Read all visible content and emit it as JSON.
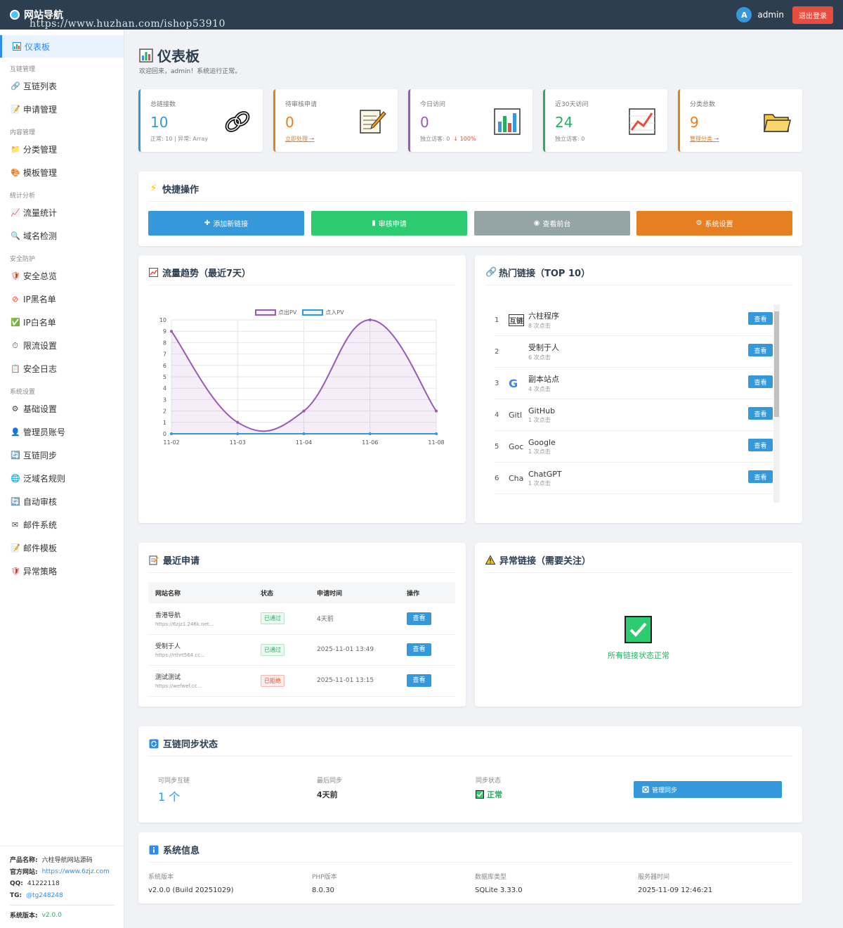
{
  "topbar": {
    "brand": "网站导航",
    "watermark": "https://www.huzhan.com/ishop53910",
    "avatar_letter": "A",
    "username": "admin",
    "logout": "退出登录"
  },
  "sidebar": {
    "active": "仪表板",
    "groups": [
      {
        "title": "互链管理",
        "items": [
          "互链列表",
          "申请管理"
        ]
      },
      {
        "title": "内容管理",
        "items": [
          "分类管理",
          "模板管理"
        ]
      },
      {
        "title": "统计分析",
        "items": [
          "流量统计",
          "域名检测"
        ]
      },
      {
        "title": "安全防护",
        "items": [
          "安全总览",
          "IP黑名单",
          "IP白名单",
          "限流设置",
          "安全日志"
        ]
      },
      {
        "title": "系统设置",
        "items": [
          "基础设置",
          "管理员账号",
          "互链同步",
          "泛域名规则",
          "自动审核",
          "邮件系统",
          "邮件模板",
          "异常策略"
        ]
      }
    ],
    "footer": {
      "product_label": "产品名称:",
      "product": "六柱导航网站源码",
      "site_label": "官方网站:",
      "site": "https://www.6zjz.com",
      "qq_label": "QQ:",
      "qq": "41222118",
      "tg_label": "TG:",
      "tg": "@tg248248",
      "version_label": "系统版本:",
      "version": "v2.0.0"
    }
  },
  "header": {
    "title": "仪表板",
    "subtitle": "欢迎回来，admin！系统运行正常。"
  },
  "stats": [
    {
      "label": "总链接数",
      "value": "10",
      "sub": "正常: 10 | 异常: Array",
      "color": "#3498db"
    },
    {
      "label": "待审核申请",
      "value": "0",
      "link": "立即处理 →",
      "color": "#e67e22"
    },
    {
      "label": "今日访问",
      "value": "0",
      "sub": "独立访客: 0",
      "trend": "↓ 100%",
      "color": "#9b59b6"
    },
    {
      "label": "近30天访问",
      "value": "24",
      "sub": "独立访客: 0",
      "color": "#27ae60"
    },
    {
      "label": "分类总数",
      "value": "9",
      "link": "管理分类 →",
      "color": "#e67e22"
    }
  ],
  "quick": {
    "title": "快捷操作",
    "buttons": [
      {
        "label": "添加新链接",
        "color": "#3498db"
      },
      {
        "label": "审核申请",
        "color": "#2ecc71"
      },
      {
        "label": "查看前台",
        "color": "#95a5a6"
      },
      {
        "label": "系统设置",
        "color": "#e67e22"
      }
    ]
  },
  "traffic": {
    "title": "流量趋势（最近7天）"
  },
  "chart_data": {
    "type": "line",
    "categories": [
      "11-02",
      "11-03",
      "11-04",
      "11-06",
      "11-08"
    ],
    "series": [
      {
        "name": "点出PV",
        "values": [
          9,
          1,
          2,
          10,
          2
        ],
        "color": "#9b59b6"
      },
      {
        "name": "点入PV",
        "values": [
          0,
          0,
          0,
          0,
          0
        ],
        "color": "#3498db"
      }
    ],
    "ylim": [
      0,
      10
    ],
    "yticks": [
      0,
      1,
      2,
      3,
      4,
      5,
      6,
      7,
      8,
      9,
      10
    ],
    "legend": "top",
    "grid": true
  },
  "hot": {
    "title": "热门链接（TOP 10）",
    "view_label": "查看",
    "items": [
      {
        "rank": "1",
        "logo": "互链",
        "name": "六柱程序",
        "clicks": "8 次点击"
      },
      {
        "rank": "2",
        "logo": "",
        "name": "受制于人",
        "clicks": "6 次点击"
      },
      {
        "rank": "3",
        "logo": "G",
        "name": "副本站点",
        "clicks": "4 次点击"
      },
      {
        "rank": "4",
        "logo": "Gitl",
        "name": "GitHub",
        "clicks": "1 次点击"
      },
      {
        "rank": "5",
        "logo": "Goc",
        "name": "Google",
        "clicks": "1 次点击"
      },
      {
        "rank": "6",
        "logo": "Cha",
        "name": "ChatGPT",
        "clicks": "1 次点击"
      }
    ]
  },
  "recent": {
    "title": "最近申请",
    "headers": [
      "网站名称",
      "状态",
      "申请时间",
      "操作"
    ],
    "rows": [
      {
        "name": "香港导航",
        "url": "https://6zjz1.246k.net...",
        "status": "已通过",
        "ok": true,
        "time": "4天前",
        "action": "查看"
      },
      {
        "name": "受制于人",
        "url": "https://rthrt564.cc...",
        "status": "已通过",
        "ok": true,
        "time": "2025-11-01 13:49",
        "action": "查看"
      },
      {
        "name": "测试测试",
        "url": "https://wefwef.cc...",
        "status": "已拒绝",
        "ok": false,
        "time": "2025-11-01 13:15",
        "action": "查看"
      }
    ]
  },
  "abnormal": {
    "title": "异常链接（需要关注）",
    "ok_text": "所有链接状态正常"
  },
  "sync": {
    "title": "互链同步状态",
    "available_label": "可同步互链",
    "available": "1 个",
    "last_label": "最后同步",
    "last": "4天前",
    "state_label": "同步状态",
    "state": "正常",
    "button": "管理同步"
  },
  "sysinfo": {
    "title": "系统信息",
    "items": [
      {
        "k": "系统版本",
        "v": "v2.0.0 (Build 20251029)"
      },
      {
        "k": "PHP版本",
        "v": "8.0.30"
      },
      {
        "k": "数据库类型",
        "v": "SQLite 3.33.0"
      },
      {
        "k": "服务器时间",
        "v": "2025-11-09 12:46:21"
      }
    ]
  }
}
